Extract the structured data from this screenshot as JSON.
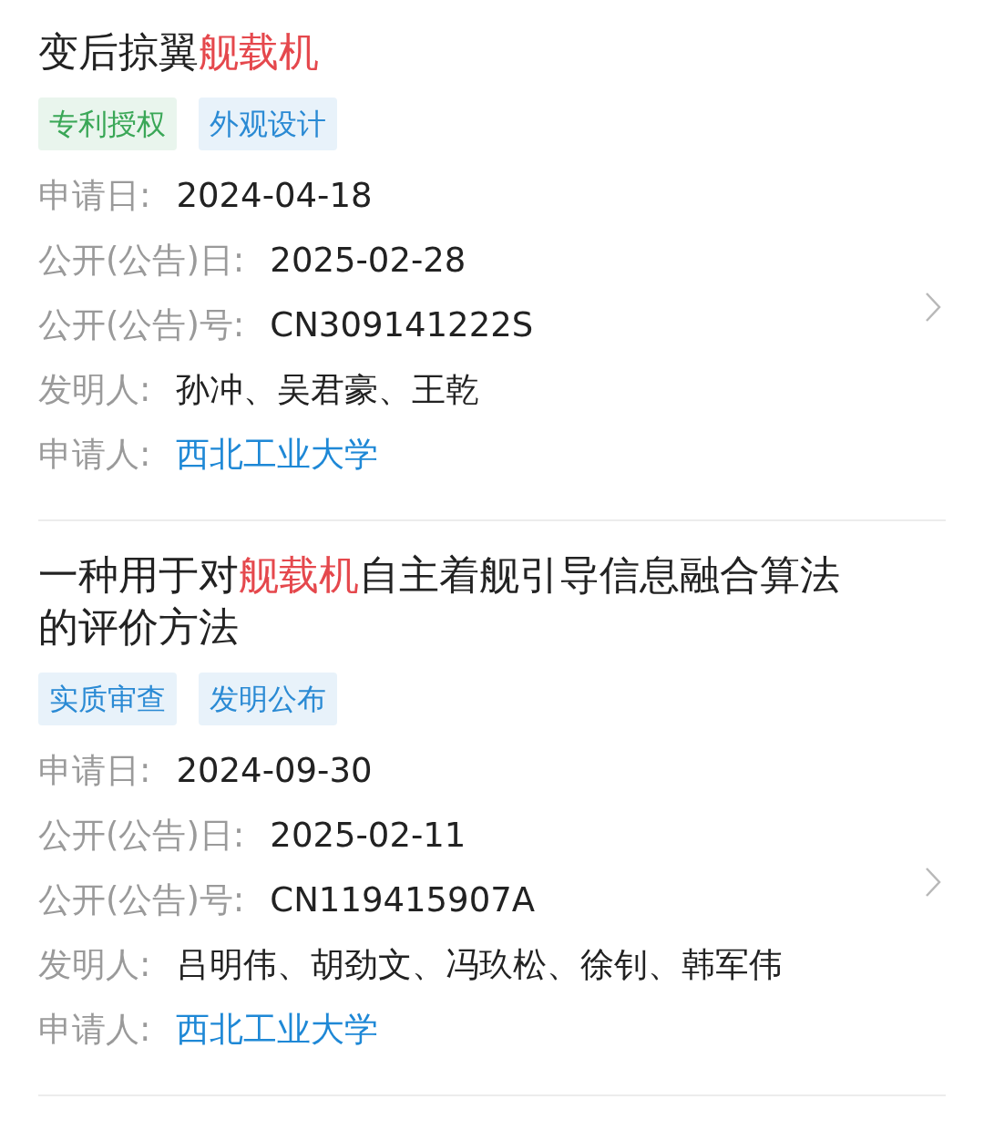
{
  "patents": [
    {
      "title": {
        "before": "变后掠翼",
        "keyword": "舰载机"
      },
      "tags": [
        {
          "label": "专利授权",
          "color": "#3aa757"
        },
        {
          "label": "外观设计",
          "color": "#2a8ad4"
        }
      ],
      "fields": [
        {
          "label": "申请日:",
          "value": "2024-04-18",
          "kind": "text"
        },
        {
          "label": "公开(公告)日:",
          "value": "2025-02-28",
          "kind": "text"
        },
        {
          "label": "公开(公告)号:",
          "value": "CN309141222S",
          "kind": "text"
        },
        {
          "label": "发明人:",
          "value": "孙冲、吴君豪、王乾",
          "kind": "text"
        },
        {
          "label": "申请人:",
          "value": "西北工业大学",
          "kind": "link"
        }
      ]
    },
    {
      "title": {
        "before": "一种用于对",
        "keyword": "舰载机",
        "after": "自主着舰引导信息融合算法的评价方法"
      },
      "tags": [
        {
          "label": "实质审查",
          "color": "#2a8ad4"
        },
        {
          "label": "发明公布",
          "color": "#2a8ad4"
        }
      ],
      "fields": [
        {
          "label": "申请日:",
          "value": "2024-09-30",
          "kind": "text"
        },
        {
          "label": "公开(公告)日:",
          "value": "2025-02-11",
          "kind": "text"
        },
        {
          "label": "公开(公告)号:",
          "value": "CN119415907A",
          "kind": "text"
        },
        {
          "label": "发明人:",
          "value": "吕明伟、胡劲文、冯玖松、徐钊、韩军伟",
          "kind": "text"
        },
        {
          "label": "申请人:",
          "value": "西北工业大学",
          "kind": "link"
        }
      ]
    }
  ]
}
